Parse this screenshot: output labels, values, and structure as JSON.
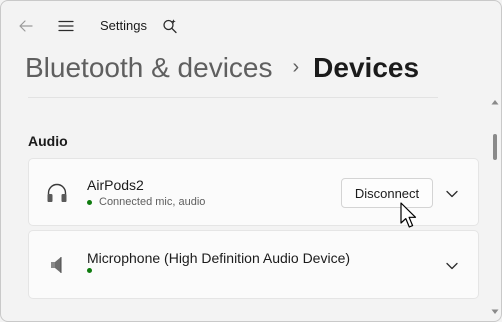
{
  "window": {
    "title": "Settings"
  },
  "breadcrumb": {
    "parent": "Bluetooth & devices",
    "separator": "›",
    "current": "Devices"
  },
  "section": {
    "title": "Audio"
  },
  "devices": [
    {
      "name": "AirPods2",
      "status": "Connected mic, audio",
      "icon": "headphones-icon",
      "button_label": "Disconnect"
    },
    {
      "name": "Microphone (High Definition Audio Device)",
      "status": "",
      "icon": "speaker-icon"
    }
  ],
  "colors": {
    "background": "#f3f3f3",
    "card": "#fbfbfb",
    "status_dot": "#0f7b0f",
    "muted_text": "#5f5f5f"
  }
}
